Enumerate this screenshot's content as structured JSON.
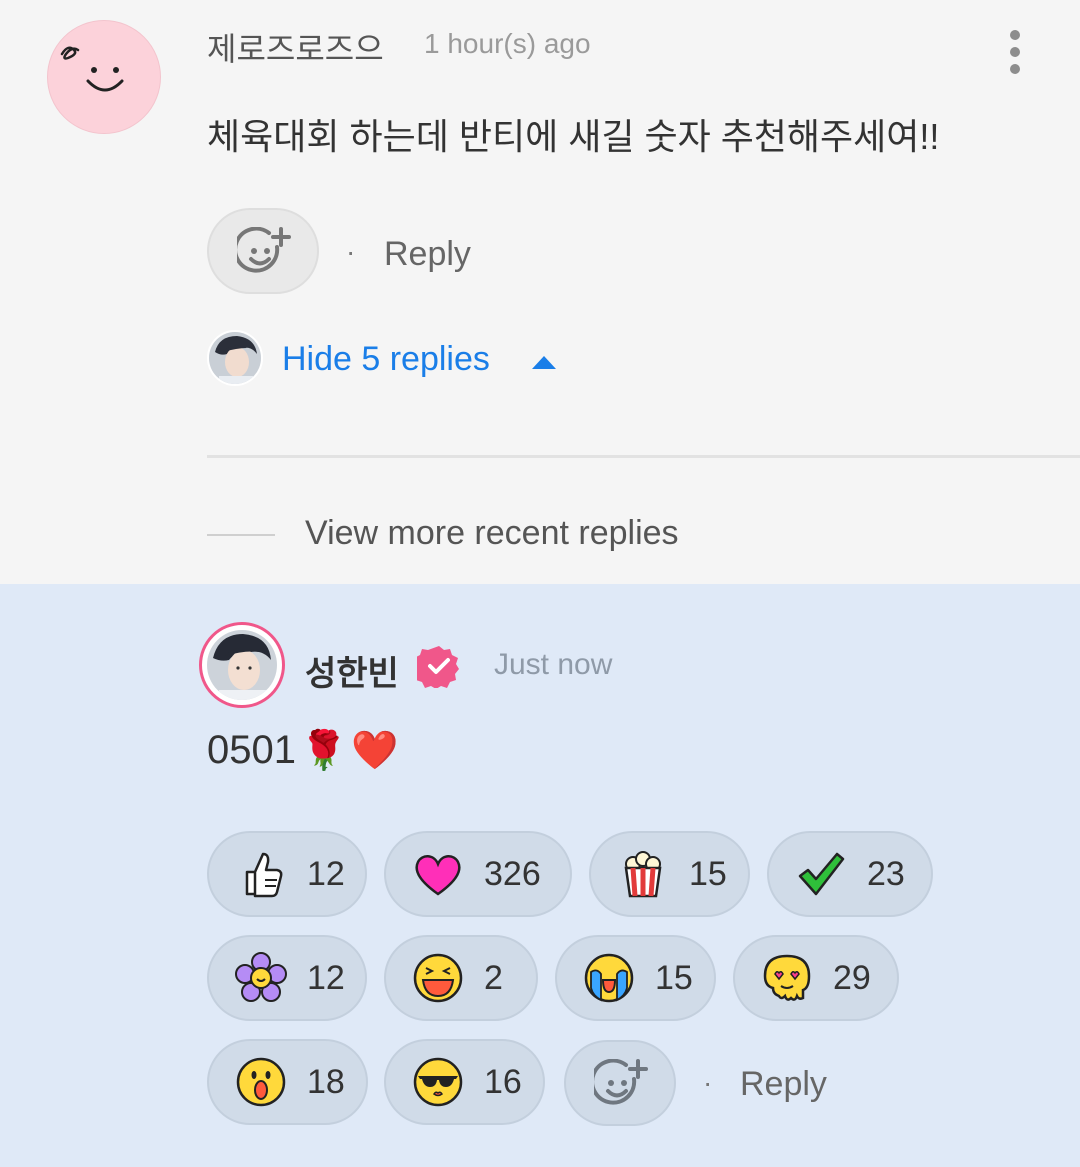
{
  "comment": {
    "username": "제로즈로즈으",
    "time": "1 hour(s) ago",
    "text": "체육대회 하는데 반티에 새길 숫자 추천해주세여!!",
    "reply_label": "Reply",
    "separator": "·",
    "hide_replies_label": "Hide 5 replies"
  },
  "view_more_label": "View more recent replies",
  "reply": {
    "username": "성한빈",
    "time": "Just now",
    "text": "0501",
    "emojis": [
      "🌹",
      "❤️"
    ],
    "separator": "·",
    "reply_label": "Reply",
    "reactions": [
      {
        "icon": "thumbs-up-icon",
        "count": "12"
      },
      {
        "icon": "heart-icon",
        "count": "326"
      },
      {
        "icon": "popcorn-icon",
        "count": "15"
      },
      {
        "icon": "checkmark-icon",
        "count": "23"
      },
      {
        "icon": "flower-icon",
        "count": "12"
      },
      {
        "icon": "laughing-face-icon",
        "count": "2"
      },
      {
        "icon": "crying-face-icon",
        "count": "15"
      },
      {
        "icon": "heart-eyes-melting-icon",
        "count": "29"
      },
      {
        "icon": "surprised-face-icon",
        "count": "18"
      },
      {
        "icon": "sunglasses-face-icon",
        "count": "16"
      }
    ]
  },
  "colors": {
    "link_blue": "#1a7ee8",
    "highlight_bg": "#dfe9f7",
    "verified_pink": "#f0578a"
  }
}
